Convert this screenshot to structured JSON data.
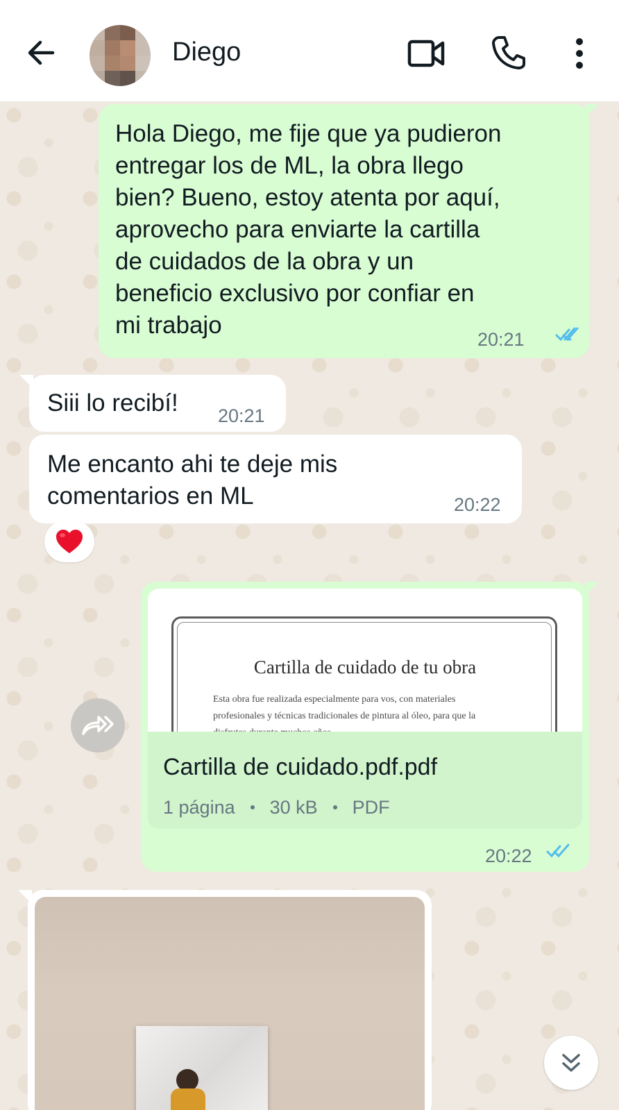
{
  "header": {
    "contact_name": "Diego"
  },
  "messages": [
    {
      "direction": "outgoing",
      "text": "Hola Diego, me fije que ya pudieron entregar los de ML, la obra llego bien? Bueno, estoy atenta por aquí, aprovecho para enviarte la cartilla de cuidados de la obra y un beneficio exclusivo por confiar en mi trabajo",
      "lines": [
        "Hola Diego, me fije que ya pudieron",
        "entregar los de ML, la obra llego",
        "bien? Bueno, estoy atenta por aquí,",
        "aprovecho para enviarte la cartilla",
        "de cuidados de la obra y un",
        "beneficio exclusivo por confiar en",
        "mi trabajo"
      ],
      "time": "20:21",
      "status": "read"
    },
    {
      "direction": "incoming",
      "text": "Siii lo recibí!",
      "time": "20:21"
    },
    {
      "direction": "incoming",
      "lines": [
        "Me encanto ahi te deje mis",
        "comentarios en ML"
      ],
      "time": "20:22",
      "reaction": "❤️"
    },
    {
      "direction": "outgoing",
      "type": "document",
      "preview": {
        "title": "Cartilla de cuidado de tu obra",
        "body_lines": [
          "Esta obra fue realizada especialmente para vos, con materiales",
          "profesionales y técnicas tradicionales de pintura al óleo, para que la",
          "disfrutes durante muchos años"
        ]
      },
      "file_name": "Cartilla de cuidado.pdf.pdf",
      "pages": "1 página",
      "size": "30 kB",
      "file_type": "PDF",
      "time": "20:22",
      "status": "read"
    },
    {
      "direction": "incoming",
      "type": "image"
    }
  ],
  "icons": {
    "back": "arrow-left-icon",
    "video": "video-camera-icon",
    "call": "phone-icon",
    "menu": "more-vertical-icon",
    "forward": "forward-icon",
    "scroll_down": "double-chevron-down-icon",
    "read_ticks": "double-check-icon"
  },
  "colors": {
    "outgoing_bubble": "#d9fdd3",
    "incoming_bubble": "#ffffff",
    "read_tick": "#53bdeb",
    "timestamp": "#667781"
  }
}
